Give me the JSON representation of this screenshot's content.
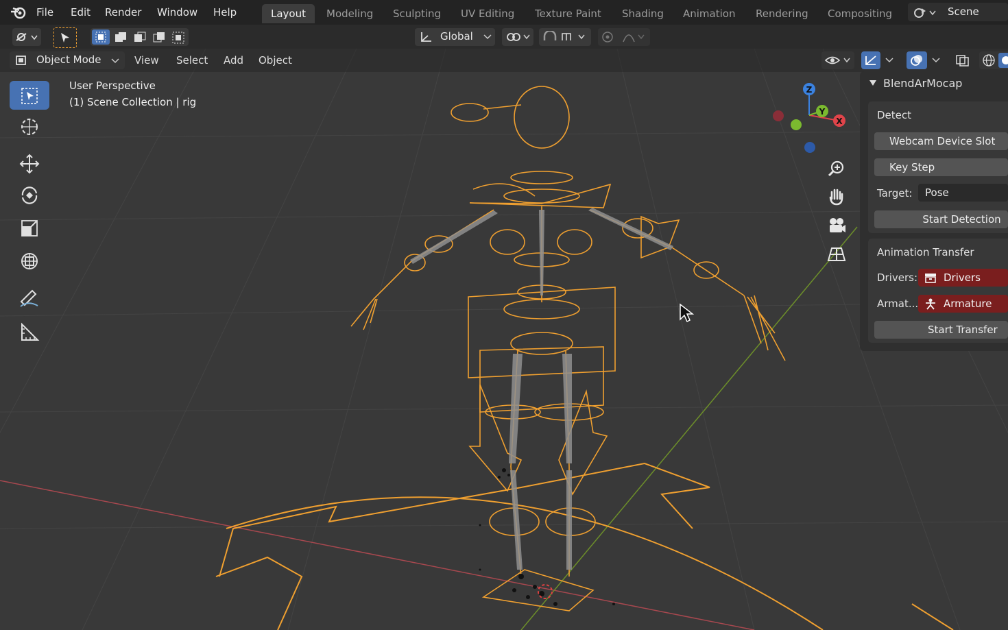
{
  "topbar": {
    "menus": [
      "File",
      "Edit",
      "Render",
      "Window",
      "Help"
    ],
    "workspaces": [
      "Layout",
      "Modeling",
      "Sculpting",
      "UV Editing",
      "Texture Paint",
      "Shading",
      "Animation",
      "Rendering",
      "Compositing"
    ],
    "active_workspace": "Layout",
    "scene_label": "Scene"
  },
  "header2": {
    "orientation": "Global"
  },
  "viewport_header": {
    "mode": "Object Mode",
    "menus": [
      "View",
      "Select",
      "Add",
      "Object"
    ]
  },
  "viewport": {
    "perspective": "User Perspective",
    "collection": "(1) Scene Collection | rig",
    "axis_labels": {
      "z": "Z",
      "y": "Y",
      "x": "X"
    }
  },
  "npanel": {
    "title": "BlendArMocap",
    "detect": {
      "heading": "Detect",
      "webcam_slot": "Webcam Device Slot",
      "key_step": "Key Step",
      "target_label": "Target:",
      "target_value": "Pose",
      "start_button": "Start Detection"
    },
    "transfer": {
      "heading": "Animation Transfer",
      "drivers_label": "Drivers:",
      "drivers_value": "Drivers",
      "armature_label": "Armat...",
      "armature_value": "Armature",
      "start_button": "Start Transfer"
    }
  },
  "colors": {
    "accent": "#4772b3",
    "selection": "#f0a030",
    "x_axis": "#e0444a",
    "y_axis": "#7bba2f",
    "z_axis": "#3b82e0"
  }
}
